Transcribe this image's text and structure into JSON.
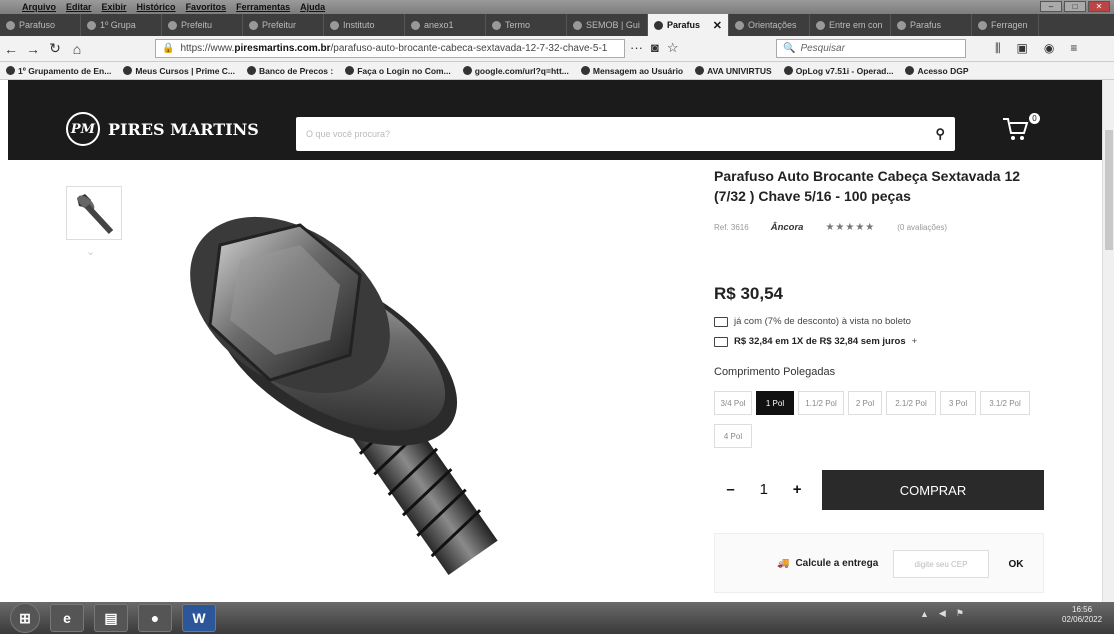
{
  "menubar": {
    "items": [
      "Arquivo",
      "Editar",
      "Exibir",
      "Histórico",
      "Favoritos",
      "Ferramentas",
      "Ajuda"
    ]
  },
  "tabs": [
    {
      "label": "Parafuso"
    },
    {
      "label": "1º Grupa"
    },
    {
      "label": "Prefeitu"
    },
    {
      "label": "Prefeitur"
    },
    {
      "label": "Instituto"
    },
    {
      "label": "anexo1"
    },
    {
      "label": "Termo"
    },
    {
      "label": "SEMOB | Gui"
    },
    {
      "label": "Parafus",
      "active": true
    },
    {
      "label": "Orientações"
    },
    {
      "label": "Entre em con"
    },
    {
      "label": "Parafus"
    },
    {
      "label": "Ferragen"
    }
  ],
  "nav": {
    "url_prefix": "https://www.",
    "url_domain": "piresmartins.com.br",
    "url_path": "/parafuso-auto-brocante-cabeca-sextavada-12-7-32-chave-5-1",
    "search_placeholder": "Pesquisar"
  },
  "bookmarks": [
    "1º Grupamento de En...",
    "Meus Cursos | Prime C...",
    "Banco de Precos :",
    "Faça o Login no Com...",
    "google.com/url?q=htt...",
    "Mensagem ao Usuário",
    "AVA UNIVIRTUS",
    "OpLog v7.51i - Operad...",
    "Acesso DGP"
  ],
  "site": {
    "logo_mark": "PM",
    "brand": "PIRES MARTINS",
    "search_placeholder": "O que você procura?",
    "cart_count": "0"
  },
  "product": {
    "title": "Parafuso Auto Brocante Cabeça Sextavada 12 (7/32 ) Chave 5/16 - 100 peças",
    "ref": "Ref. 3616",
    "brand": "Âncora",
    "stars": "★★★★★",
    "reviews": "(0 avaliações)",
    "price": "R$ 30,54",
    "discount_line": "já com (7% de desconto) à vista no boleto",
    "installment_line": "R$ 32,84 em 1X de R$ 32,84 sem juros",
    "option_label": "Comprimento Polegadas",
    "options": [
      "3/4 Pol",
      "1 Pol",
      "1.1/2 Pol",
      "2 Pol",
      "2.1/2 Pol",
      "3 Pol",
      "3.1/2 Pol",
      "4 Pol"
    ],
    "selected_option": "1 Pol",
    "quantity": "1",
    "buy_label": "COMPRAR",
    "shipping_label": "Calcule a entrega",
    "cep_placeholder": "digite seu CEP",
    "ok_label": "OK"
  },
  "taskbar": {
    "clock_time": "16:56",
    "clock_date": "02/06/2022",
    "app_w": "W"
  }
}
